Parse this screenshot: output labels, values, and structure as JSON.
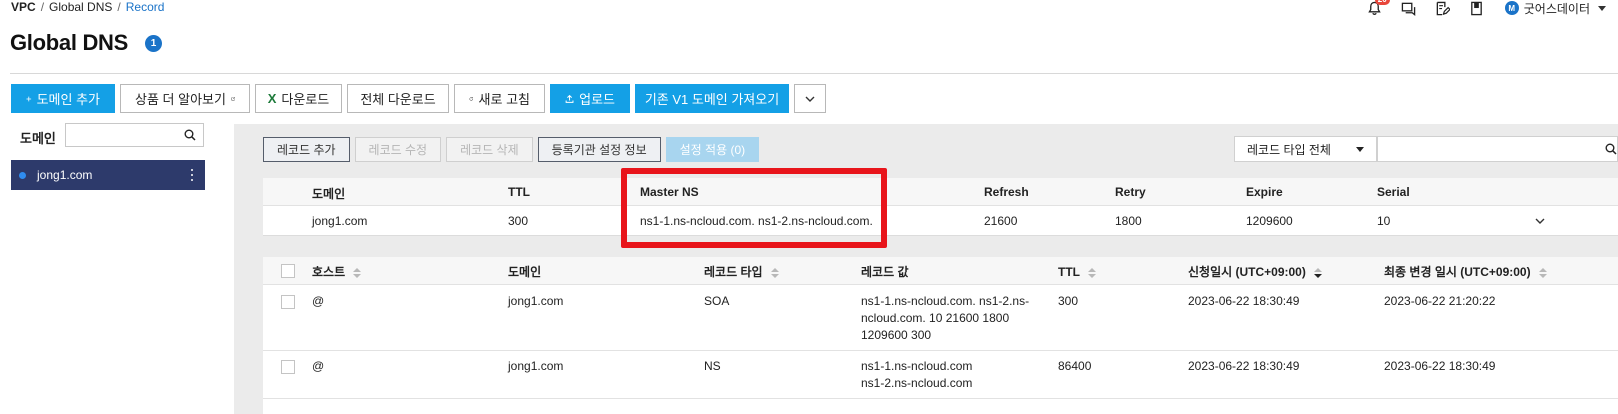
{
  "breadcrumb": {
    "items": [
      "VPC",
      "Global DNS",
      "Record"
    ],
    "sep": "/"
  },
  "topbar": {
    "notif_count": "20",
    "user_initial": "M",
    "user_name": "굿어스데이터"
  },
  "page": {
    "title": "Global DNS",
    "badge": "1"
  },
  "toolbar": {
    "add_domain": "도메인 추가",
    "learn_more": "상품 더 알아보기",
    "download": "다운로드",
    "download_all": "전체 다운로드",
    "refresh": "새로 고침",
    "upload": "업로드",
    "import_v1": "기존 V1 도메인 가져오기",
    "excel_glyph": "X"
  },
  "sidebar": {
    "label": "도메인",
    "search_value": "",
    "items": [
      {
        "name": "jong1.com"
      }
    ]
  },
  "records_toolbar": {
    "add": "레코드 추가",
    "edit": "레코드 수정",
    "delete": "레코드 삭제",
    "registrar": "등록기관 설정 정보",
    "apply": "설정 적용 (0)",
    "type_filter": "레코드 타입 전체",
    "search_value": ""
  },
  "soa_table": {
    "headers": [
      "도메인",
      "TTL",
      "Master NS",
      "Refresh",
      "Retry",
      "Expire",
      "Serial"
    ],
    "row": {
      "domain": "jong1.com",
      "ttl": "300",
      "master_ns": "ns1-1.ns-ncloud.com. ns1-2.ns-ncloud.com.",
      "refresh": "21600",
      "retry": "1800",
      "expire": "1209600",
      "serial": "10"
    }
  },
  "records_table": {
    "headers": [
      "호스트",
      "도메인",
      "레코드 타입",
      "레코드 값",
      "TTL",
      "신청일시 (UTC+09:00)",
      "최종 변경 일시 (UTC+09:00)"
    ],
    "rows": [
      {
        "host": "@",
        "domain": "jong1.com",
        "type": "SOA",
        "value_lines": [
          "ns1-1.ns-ncloud.com. ns1-2.ns-",
          "ncloud.com. 10 21600 1800",
          "1209600 300"
        ],
        "ttl": "300",
        "created": "2023-06-22 18:30:49",
        "updated": "2023-06-22 21:20:22"
      },
      {
        "host": "@",
        "domain": "jong1.com",
        "type": "NS",
        "value_lines": [
          "ns1-1.ns-ncloud.com",
          "ns1-2.ns-ncloud.com"
        ],
        "ttl": "86400",
        "created": "2023-06-22 18:30:49",
        "updated": "2023-06-22 18:30:49"
      }
    ]
  },
  "colors": {
    "primary": "#14a0e6",
    "selected_domain_bg": "#2d3a6b",
    "highlight": "#e8151b",
    "badge": "#1a73c8"
  }
}
